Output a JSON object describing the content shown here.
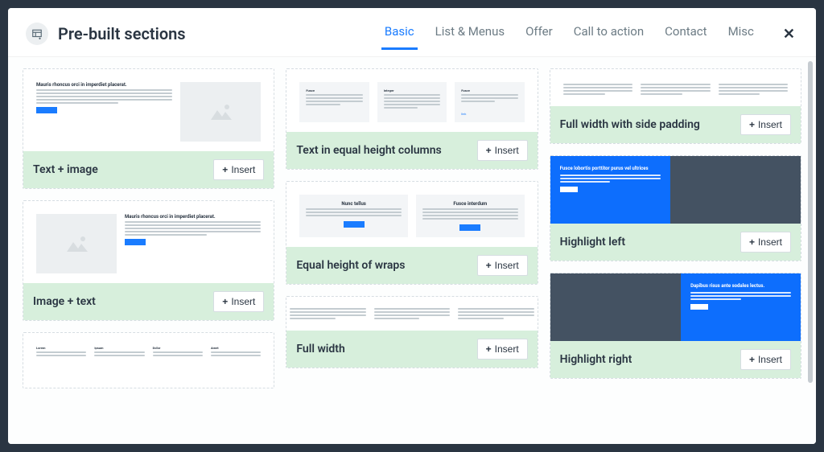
{
  "header": {
    "title": "Pre-built sections"
  },
  "tabs": [
    {
      "label": "Basic",
      "active": true
    },
    {
      "label": "List & Menus"
    },
    {
      "label": "Offer"
    },
    {
      "label": "Call to action"
    },
    {
      "label": "Contact"
    },
    {
      "label": "Misc"
    }
  ],
  "insert_label": "Insert",
  "cards": {
    "text_image": "Text + image",
    "image_text": "Image + text",
    "text_eq_cols": "Text in equal height columns",
    "eq_wraps": "Equal height of wraps",
    "full_width": "Full width",
    "full_width_pad": "Full width with side padding",
    "highlight_left": "Highlight left",
    "highlight_right": "Highlight right"
  },
  "preview_strings": {
    "lorem_head": "Mauris rhoncus orci in imperdiet placerat.",
    "nunc": "Nunc tellus",
    "fusce": "Fusce interdum",
    "fusce_lob": "Fusce lobortis porttitor purus vel ultrices",
    "dapibus": "Dapibus risus ante sodales lectus."
  }
}
